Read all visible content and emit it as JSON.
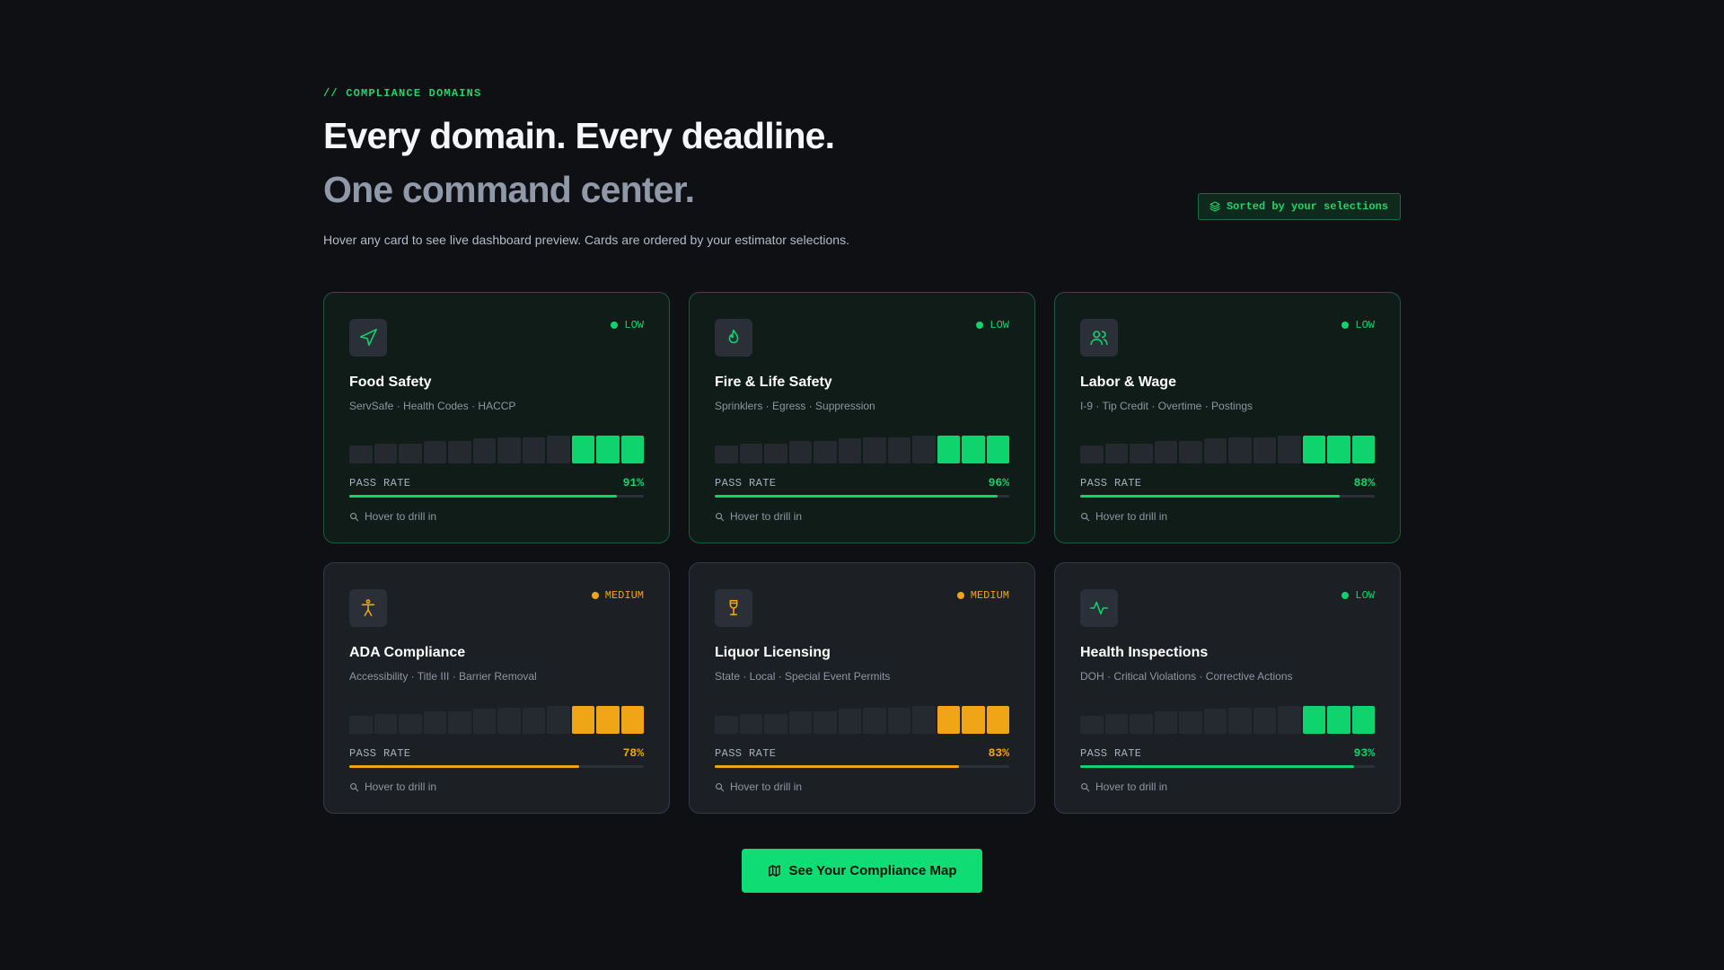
{
  "header": {
    "eyebrow": "// COMPLIANCE DOMAINS",
    "title": "Every domain. Every deadline.",
    "subtitle": "One command center.",
    "description": "Hover any card to see live dashboard preview. Cards are ordered by your estimator selections.",
    "sort_badge": "Sorted by your selections",
    "sort_badge_icon": "layers-icon"
  },
  "colors": {
    "green": "#0fd46d",
    "amber": "#f0a516",
    "bar_idle": "#252a31"
  },
  "cards": [
    {
      "icon": "navigation-icon",
      "risk": "LOW",
      "status": "good",
      "title": "Food Safety",
      "subtitle": "ServSafe · Health Codes · HACCP",
      "pass_label": "PASS RATE",
      "pass_rate": "91%",
      "pass_value": 91,
      "drill": "Hover to drill in"
    },
    {
      "icon": "flame-icon",
      "risk": "LOW",
      "status": "good",
      "title": "Fire & Life Safety",
      "subtitle": "Sprinklers · Egress · Suppression",
      "pass_label": "PASS RATE",
      "pass_rate": "96%",
      "pass_value": 96,
      "drill": "Hover to drill in"
    },
    {
      "icon": "users-icon",
      "risk": "LOW",
      "status": "good",
      "title": "Labor & Wage",
      "subtitle": "I-9 · Tip Credit · Overtime · Postings",
      "pass_label": "PASS RATE",
      "pass_rate": "88%",
      "pass_value": 88,
      "drill": "Hover to drill in"
    },
    {
      "icon": "accessibility-icon",
      "risk": "MEDIUM",
      "status": "warn",
      "title": "ADA Compliance",
      "subtitle": "Accessibility · Title III · Barrier Removal",
      "pass_label": "PASS RATE",
      "pass_rate": "78%",
      "pass_value": 78,
      "drill": "Hover to drill in"
    },
    {
      "icon": "wine-glass-icon",
      "risk": "MEDIUM",
      "status": "warn",
      "title": "Liquor Licensing",
      "subtitle": "State · Local · Special Event Permits",
      "pass_label": "PASS RATE",
      "pass_rate": "83%",
      "pass_value": 83,
      "drill": "Hover to drill in"
    },
    {
      "icon": "activity-icon",
      "risk": "LOW",
      "status": "warn-green",
      "title": "Health Inspections",
      "subtitle": "DOH · Critical Violations · Corrective Actions",
      "pass_label": "PASS RATE",
      "pass_rate": "93%",
      "pass_value": 93,
      "drill": "Hover to drill in"
    }
  ],
  "cta": {
    "label": "See Your Compliance Map",
    "icon": "map-icon"
  }
}
